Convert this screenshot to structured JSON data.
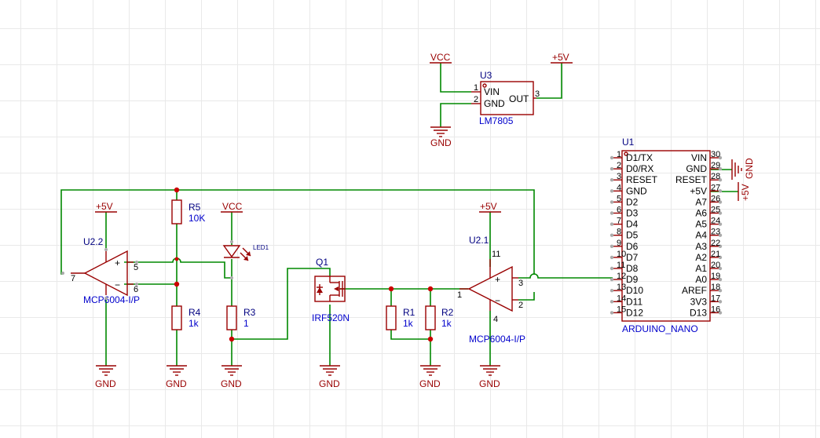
{
  "power_labels": {
    "vcc": "VCC",
    "plus5v": "+5V",
    "gnd": "GND"
  },
  "u3": {
    "designator": "U3",
    "value": "LM7805",
    "pins": [
      {
        "num": "1",
        "name": "VIN"
      },
      {
        "num": "2",
        "name": "GND"
      },
      {
        "num": "3",
        "name": "OUT"
      }
    ]
  },
  "u1": {
    "designator": "U1",
    "value": "ARDUINO_NANO",
    "left_pins": [
      {
        "num": "1",
        "name": "D1/TX"
      },
      {
        "num": "2",
        "name": "D0/RX"
      },
      {
        "num": "3",
        "name": "RESET"
      },
      {
        "num": "4",
        "name": "GND"
      },
      {
        "num": "5",
        "name": "D2"
      },
      {
        "num": "6",
        "name": "D3"
      },
      {
        "num": "7",
        "name": "D4"
      },
      {
        "num": "8",
        "name": "D5"
      },
      {
        "num": "9",
        "name": "D6"
      },
      {
        "num": "10",
        "name": "D7"
      },
      {
        "num": "11",
        "name": "D8"
      },
      {
        "num": "12",
        "name": "D9"
      },
      {
        "num": "13",
        "name": "D10"
      },
      {
        "num": "14",
        "name": "D11"
      },
      {
        "num": "15",
        "name": "D12"
      }
    ],
    "right_pins": [
      {
        "num": "30",
        "name": "VIN"
      },
      {
        "num": "29",
        "name": "GND"
      },
      {
        "num": "28",
        "name": "RESET"
      },
      {
        "num": "27",
        "name": "+5V"
      },
      {
        "num": "26",
        "name": "A7"
      },
      {
        "num": "25",
        "name": "A6"
      },
      {
        "num": "24",
        "name": "A5"
      },
      {
        "num": "23",
        "name": "A4"
      },
      {
        "num": "22",
        "name": "A3"
      },
      {
        "num": "21",
        "name": "A2"
      },
      {
        "num": "20",
        "name": "A1"
      },
      {
        "num": "19",
        "name": "A0"
      },
      {
        "num": "18",
        "name": "AREF"
      },
      {
        "num": "17",
        "name": "3V3"
      },
      {
        "num": "16",
        "name": "D13"
      }
    ]
  },
  "u2_2": {
    "designator": "U2.2",
    "value": "MCP6004-I/P",
    "pin_out": "7",
    "pin_plus": "5",
    "pin_minus": "6",
    "plus_sign": "+",
    "minus_sign": "−"
  },
  "u2_1": {
    "designator": "U2.1",
    "value": "MCP6004-I/P",
    "pin_out": "1",
    "pin_plus": "3",
    "pin_minus": "2",
    "pin_vdd": "11",
    "pin_vss": "4",
    "plus_sign": "+",
    "minus_sign": "−"
  },
  "r5": {
    "designator": "R5",
    "value": "10K"
  },
  "r4": {
    "designator": "R4",
    "value": "1k"
  },
  "r3": {
    "designator": "R3",
    "value": "1"
  },
  "r1": {
    "designator": "R1",
    "value": "1k"
  },
  "r2": {
    "designator": "R2",
    "value": "1k"
  },
  "led1": {
    "designator": "LED1"
  },
  "q1": {
    "designator": "Q1",
    "value": "IRF520N"
  }
}
